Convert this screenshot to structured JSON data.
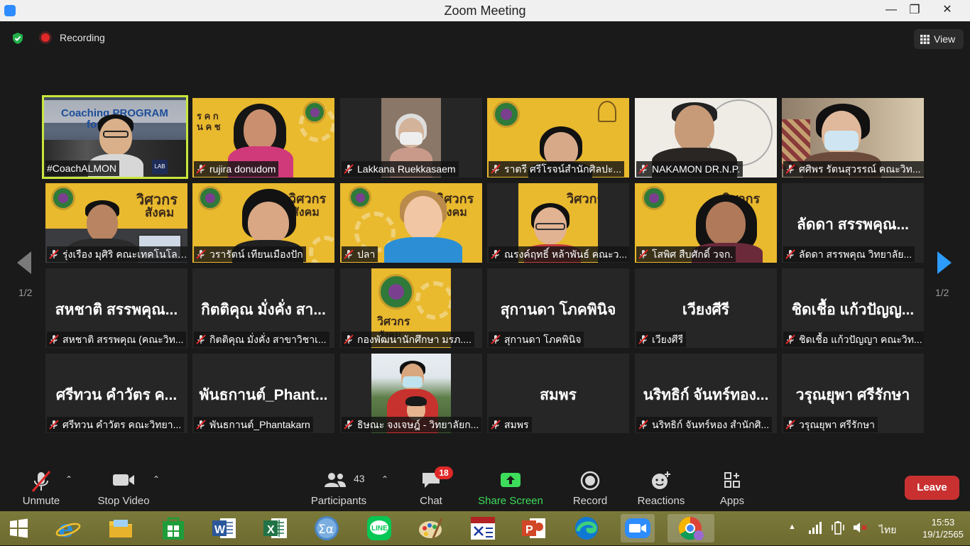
{
  "window": {
    "title": "Zoom Meeting",
    "minimize": "—",
    "maximize": "❐",
    "close": "✕"
  },
  "header": {
    "recording_label": "Recording",
    "view_label": "View"
  },
  "pagination": {
    "left": "1/2",
    "right": "1/2"
  },
  "participants": [
    {
      "name": "#CoachALMON",
      "big": "",
      "muted": false,
      "active": true
    },
    {
      "name": "rujira donudom",
      "big": "",
      "muted": true
    },
    {
      "name": "Lakkana Ruekkasaem",
      "big": "",
      "muted": true
    },
    {
      "name": "ราตรี ศรีโรจน์สำนักศิลปะ...",
      "big": "",
      "muted": true
    },
    {
      "name": "NAKAMON DR.N.P.",
      "big": "",
      "muted": true
    },
    {
      "name": "ศศิพร รัตนสุวรรณ์ คณะวิท...",
      "big": "",
      "muted": true
    },
    {
      "name": "รุ่งเรือง มุศิริ คณะเทคโนโลย...",
      "big": "",
      "muted": true
    },
    {
      "name": "วรารัตน์ เทียนเมืองปัก",
      "big": "",
      "muted": true
    },
    {
      "name": "ปลา",
      "big": "",
      "muted": true
    },
    {
      "name": "ณรงค์ฤทธิ์ หล้าพันธ์ คณะว...",
      "big": "",
      "muted": true
    },
    {
      "name": "โสพิศ สืบศักดิ์ วจก.",
      "big": "",
      "muted": true
    },
    {
      "name": "ลัดดา สรรพคุณ วิทยาลัย...",
      "big": "ลัดดา สรรพคุณ...",
      "muted": true
    },
    {
      "name": "สหชาติ สรรพคุณ (คณะวิท...",
      "big": "สหชาติ สรรพคุณ...",
      "muted": true
    },
    {
      "name": "กิตติคุณ มั่งคั่ง สาขาวิชาเ...",
      "big": "กิตติคุณ มั่งคั่ง สา...",
      "muted": true
    },
    {
      "name": "กองพัฒนานักศึกษา มรภ....",
      "big": "",
      "muted": true
    },
    {
      "name": "สุกานดา โภคพินิจ",
      "big": "สุกานดา โภคพินิจ",
      "muted": true
    },
    {
      "name": "เวียงศีรี",
      "big": "เวียงศีรี",
      "muted": true
    },
    {
      "name": "ชิดเชื้อ แก้วปัญญา คณะวิท...",
      "big": "ชิดเชื้อ แก้วปัญญ...",
      "muted": true
    },
    {
      "name": "ศรีทวน คำวัตร คณะวิทยา...",
      "big": "ศรีทวน คำวัตร ค...",
      "muted": true
    },
    {
      "name": "พันธกานต์_Phantakarn",
      "big": "พันธกานต์_Phant...",
      "muted": true
    },
    {
      "name": "ธิษณะ จงเจษฎ์ - วิทยาลัยก...",
      "big": "",
      "muted": true
    },
    {
      "name": "สมพร",
      "big": "สมพร",
      "muted": true
    },
    {
      "name": "นริทธิก์ จันทร์หอง สำนักศิ...",
      "big": "นริทธิก์ จันทร์ทอง...",
      "muted": true
    },
    {
      "name": "วรุณยุพา ศรีรักษา",
      "big": "วรุณยุพา ศรีรักษา",
      "muted": true
    }
  ],
  "video_overlay_text": {
    "coaching": "Coaching PROGRAM",
    "for": "for       ter",
    "wisawakorn_1": "วิศวกร",
    "wisawakorn_2": "สังคม",
    "rasad_1": "ร ค ก",
    "rasad_2": "น ค ช",
    "lab": "LAB"
  },
  "toolbar": {
    "unmute": "Unmute",
    "stop_video": "Stop Video",
    "participants": "Participants",
    "participants_count": "43",
    "chat": "Chat",
    "chat_badge": "18",
    "share_screen": "Share Screen",
    "record": "Record",
    "reactions": "Reactions",
    "apps": "Apps",
    "leave": "Leave"
  },
  "taskbar": {
    "language": "ไทย",
    "time": "15:53",
    "date": "19/1/2565",
    "apps": [
      "start",
      "internet-explorer",
      "file-explorer",
      "store",
      "word",
      "excel",
      "calculator",
      "line",
      "paint",
      "lisrel",
      "powerpoint",
      "edge",
      "zoom",
      "chrome"
    ]
  },
  "colors": {
    "accent_green": "#3ddc5b",
    "leave_red": "#c93131",
    "badge_red": "#e02828",
    "active_outline": "#c8e63c",
    "nav_blue": "#2d9cff",
    "tile_bg": "#262626"
  }
}
